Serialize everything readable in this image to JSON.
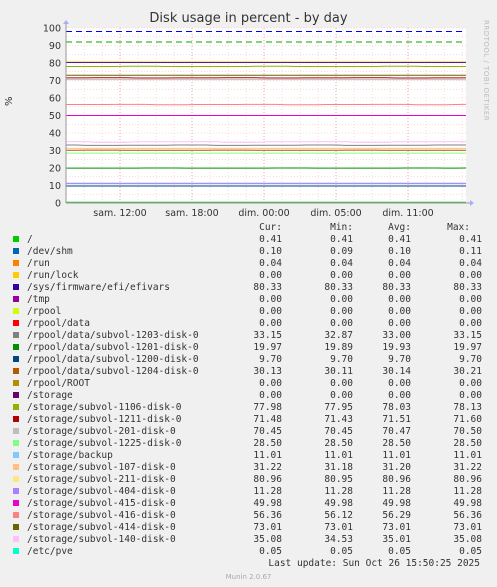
{
  "chart_data": {
    "type": "line",
    "title": "Disk usage in percent - by day",
    "ylabel": "%",
    "ylim": [
      0,
      100
    ],
    "yticks": [
      0,
      10,
      20,
      30,
      40,
      50,
      60,
      70,
      80,
      90,
      100
    ],
    "xticks": [
      "sam. 12:00",
      "sam. 18:00",
      "dim. 00:00",
      "dim. 05:00",
      "dim. 11:00"
    ],
    "threshold_lines": [
      92,
      98
    ],
    "series": [
      {
        "name": "/",
        "color": "#00cc00",
        "cur": "0.41",
        "min": "0.41",
        "avg": "0.41",
        "max": "0.41"
      },
      {
        "name": "/dev/shm",
        "color": "#0066b3",
        "cur": "0.10",
        "min": "0.09",
        "avg": "0.10",
        "max": "0.11"
      },
      {
        "name": "/run",
        "color": "#ff8000",
        "cur": "0.04",
        "min": "0.04",
        "avg": "0.04",
        "max": "0.04"
      },
      {
        "name": "/run/lock",
        "color": "#ffcc00",
        "cur": "0.00",
        "min": "0.00",
        "avg": "0.00",
        "max": "0.00"
      },
      {
        "name": "/sys/firmware/efi/efivars",
        "color": "#330099",
        "cur": "80.33",
        "min": "80.33",
        "avg": "80.33",
        "max": "80.33"
      },
      {
        "name": "/tmp",
        "color": "#990099",
        "cur": "0.00",
        "min": "0.00",
        "avg": "0.00",
        "max": "0.00"
      },
      {
        "name": "/rpool",
        "color": "#ccff00",
        "cur": "0.00",
        "min": "0.00",
        "avg": "0.00",
        "max": "0.00"
      },
      {
        "name": "/rpool/data",
        "color": "#ff0000",
        "cur": "0.00",
        "min": "0.00",
        "avg": "0.00",
        "max": "0.00"
      },
      {
        "name": "/rpool/data/subvol-1203-disk-0",
        "color": "#808080",
        "cur": "33.15",
        "min": "32.87",
        "avg": "33.00",
        "max": "33.15"
      },
      {
        "name": "/rpool/data/subvol-1201-disk-0",
        "color": "#008f00",
        "cur": "19.97",
        "min": "19.89",
        "avg": "19.93",
        "max": "19.97"
      },
      {
        "name": "/rpool/data/subvol-1200-disk-0",
        "color": "#00487d",
        "cur": "9.70",
        "min": "9.70",
        "avg": "9.70",
        "max": "9.70"
      },
      {
        "name": "/rpool/data/subvol-1204-disk-0",
        "color": "#b35a00",
        "cur": "30.13",
        "min": "30.11",
        "avg": "30.14",
        "max": "30.21"
      },
      {
        "name": "/rpool/ROOT",
        "color": "#b38f00",
        "cur": "0.00",
        "min": "0.00",
        "avg": "0.00",
        "max": "0.00"
      },
      {
        "name": "/storage",
        "color": "#6b006b",
        "cur": "0.00",
        "min": "0.00",
        "avg": "0.00",
        "max": "0.00"
      },
      {
        "name": "/storage/subvol-1106-disk-0",
        "color": "#8fb300",
        "cur": "77.98",
        "min": "77.95",
        "avg": "78.03",
        "max": "78.13"
      },
      {
        "name": "/storage/subvol-1211-disk-0",
        "color": "#b30000",
        "cur": "71.48",
        "min": "71.43",
        "avg": "71.51",
        "max": "71.60"
      },
      {
        "name": "/storage/subvol-201-disk-0",
        "color": "#bebebe",
        "cur": "70.45",
        "min": "70.45",
        "avg": "70.47",
        "max": "70.50"
      },
      {
        "name": "/storage/subvol-1225-disk-0",
        "color": "#80ff80",
        "cur": "28.50",
        "min": "28.50",
        "avg": "28.50",
        "max": "28.50"
      },
      {
        "name": "/storage/backup",
        "color": "#80c9ff",
        "cur": "11.01",
        "min": "11.01",
        "avg": "11.01",
        "max": "11.01"
      },
      {
        "name": "/storage/subvol-107-disk-0",
        "color": "#ffc080",
        "cur": "31.22",
        "min": "31.18",
        "avg": "31.20",
        "max": "31.22"
      },
      {
        "name": "/storage/subvol-211-disk-0",
        "color": "#ffe680",
        "cur": "80.96",
        "min": "80.95",
        "avg": "80.96",
        "max": "80.96"
      },
      {
        "name": "/storage/subvol-404-disk-0",
        "color": "#aa80ff",
        "cur": "11.28",
        "min": "11.28",
        "avg": "11.28",
        "max": "11.28"
      },
      {
        "name": "/storage/subvol-415-disk-0",
        "color": "#ee00cc",
        "cur": "49.98",
        "min": "49.98",
        "avg": "49.98",
        "max": "49.98"
      },
      {
        "name": "/storage/subvol-416-disk-0",
        "color": "#ff8080",
        "cur": "56.36",
        "min": "56.12",
        "avg": "56.29",
        "max": "56.36"
      },
      {
        "name": "/storage/subvol-414-disk-0",
        "color": "#666600",
        "cur": "73.01",
        "min": "73.01",
        "avg": "73.01",
        "max": "73.01"
      },
      {
        "name": "/storage/subvol-140-disk-0",
        "color": "#ffbfff",
        "cur": "35.08",
        "min": "34.53",
        "avg": "35.01",
        "max": "35.08"
      },
      {
        "name": "/etc/pve",
        "color": "#00ffcc",
        "cur": "0.05",
        "min": "0.05",
        "avg": "0.05",
        "max": "0.05"
      }
    ]
  },
  "legend": {
    "cur": "Cur:",
    "min": "Min:",
    "avg": "Avg:",
    "max": "Max:"
  },
  "watermark": "RRDTOOL / TOBI OETIKER",
  "last_update": "Last update: Sun Oct 26 15:50:25 2025",
  "version": "Munin 2.0.67",
  "colors": {
    "background": "#f0f0f0",
    "plot_bg": "#ffffff",
    "grid_minor": "#ffb0b0",
    "warning": "#00aa00",
    "critical": "#0000ff"
  }
}
